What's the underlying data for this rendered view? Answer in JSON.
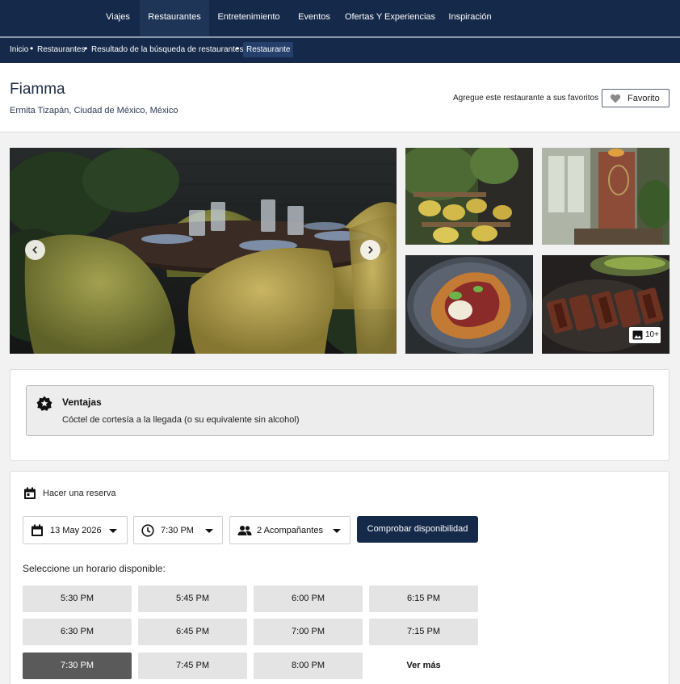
{
  "nav": {
    "items": [
      "Viajes",
      "Restaurantes",
      "Entretenimiento",
      "Eventos",
      "Ofertas Y Experiencias",
      "Inspiración"
    ],
    "active": "Restaurantes"
  },
  "breadcrumb": {
    "items": [
      "Inicio",
      "Restaurantes",
      "Resultado de la búsqueda de restaurantes"
    ],
    "current": "Restaurante",
    "separator": "•"
  },
  "restaurant": {
    "name": "Fiamma",
    "location": "Ermita Tizapán, Ciudad de México, México",
    "favorite_prompt": "Agregue este restaurante a sus favoritos",
    "favorite_label": "Favorito"
  },
  "gallery": {
    "more_count": "10+",
    "prev_icon": "chevron-left-icon",
    "next_icon": "chevron-right-icon"
  },
  "perks": {
    "title": "Ventajas",
    "description": "Cóctel de cortesía a la llegada (o su equivalente sin alcohol)"
  },
  "reservation": {
    "title": "Hacer una reserva",
    "date": "13 May 2026",
    "time": "7:30 PM",
    "guests": "2 Acompañantes",
    "check_label": "Comprobar disponibilidad",
    "slots_label": "Seleccione un horario disponible:",
    "slots": [
      "5:30 PM",
      "5:45 PM",
      "6:00 PM",
      "6:15 PM",
      "6:30 PM",
      "6:45 PM",
      "7:00 PM",
      "7:15 PM",
      "7:30 PM",
      "7:45 PM",
      "8:00 PM"
    ],
    "selected_slot": "7:30 PM",
    "more_label": "Ver más"
  },
  "colors": {
    "navy": "#15294a",
    "selected_slot": "#5a5a5a"
  }
}
